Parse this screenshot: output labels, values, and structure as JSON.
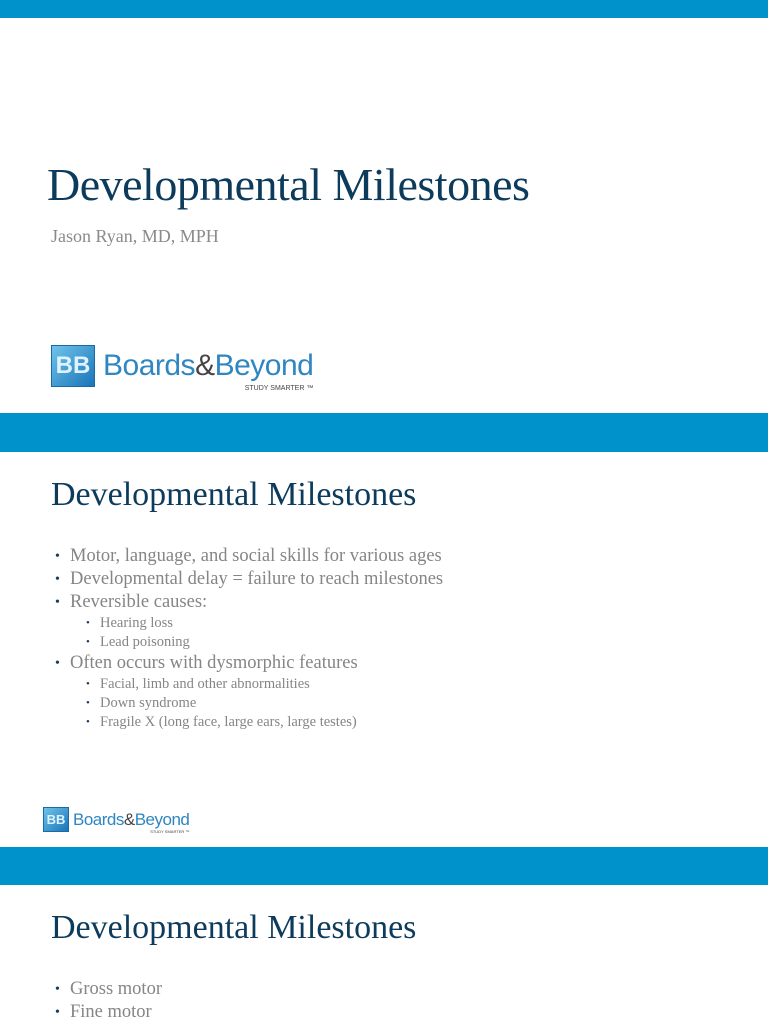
{
  "colors": {
    "accent": "#0093cb",
    "title": "#0d3b5c",
    "body": "#858585"
  },
  "slide1": {
    "title": "Developmental Milestones",
    "author": "Jason Ryan, MD, MPH"
  },
  "logo": {
    "mark": "BB",
    "name_a": "Boards",
    "amp": "&",
    "name_b": "Beyond",
    "tagline": "STUDY SMARTER ™"
  },
  "slide2": {
    "title": "Developmental Milestones",
    "bullets": [
      "Motor, language, and social skills for various ages",
      "Developmental delay = failure to reach milestones",
      "Reversible causes:",
      "Hearing loss",
      "Lead poisoning",
      "Often occurs with dysmorphic features",
      "Facial, limb and other abnormalities",
      "Down syndrome",
      "Fragile X (long face, large ears, large testes)"
    ]
  },
  "slide3": {
    "title": "Developmental Milestones",
    "bullets": [
      "Gross motor",
      "Fine motor"
    ]
  }
}
